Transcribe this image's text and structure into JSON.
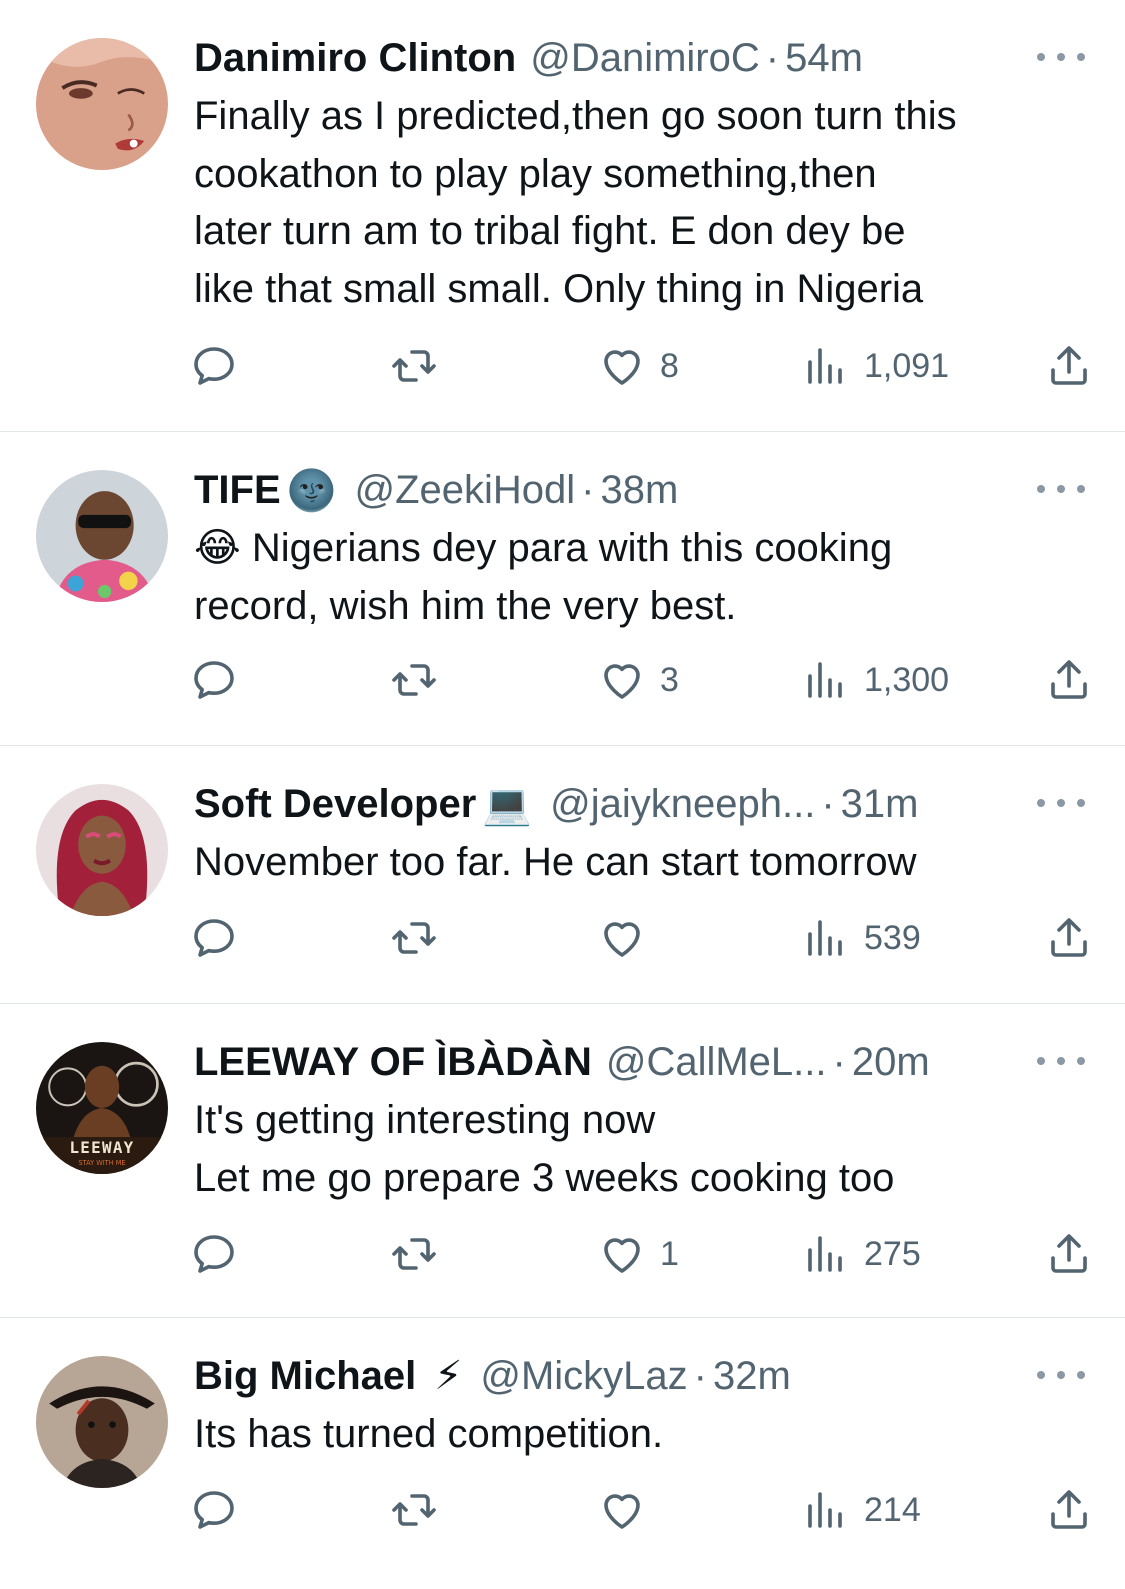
{
  "tweets": [
    {
      "name": "Danimiro Clinton",
      "badge": "",
      "handle": "@DanimiroC",
      "time": "54m",
      "lines": [
        "Finally as I predicted,then go soon turn this",
        "cookathon to play play something,then",
        "later turn am to tribal fight. E don dey be",
        "like that small small. Only thing in Nigeria"
      ],
      "likes": "8",
      "views": "1,091",
      "avatar": "cartoon-woman"
    },
    {
      "name": "TIFE",
      "badge": "🌚",
      "handle": "@ZeekiHodl",
      "time": "38m",
      "lines": [
        "😂 Nigerians dey para with this cooking",
        "record, wish him the very best."
      ],
      "likes": "3",
      "views": "1,300",
      "avatar": "man-sunglasses"
    },
    {
      "name": "Soft Developer",
      "badge": "💻",
      "handle": "@jaiykneeph...",
      "time": "31m",
      "lines": [
        "November too far. He can start tomorrow"
      ],
      "likes": "",
      "views": "539",
      "avatar": "woman-red-braids"
    },
    {
      "name": "LEEWAY OF ÌBÀDÀN",
      "badge": "",
      "handle": "@CallMeL...",
      "time": "20m",
      "lines": [
        "It's getting interesting now",
        "Let me go prepare 3 weeks cooking too"
      ],
      "likes": "1",
      "views": "275",
      "avatar": "leeway-poster",
      "avatar_text": "LEEWAY",
      "avatar_subtext": "STAY WITH ME"
    },
    {
      "name": "Big Michael",
      "badge": "⚡",
      "handle": "@MickyLaz",
      "time": "32m",
      "lines": [
        "Its has turned competition."
      ],
      "likes": "",
      "views": "214",
      "avatar": "man-hat"
    }
  ],
  "separator": "·",
  "icons": {
    "reply": "reply-icon",
    "retweet": "retweet-icon",
    "like": "heart-icon",
    "views": "views-icon",
    "share": "share-icon",
    "more": "more-icon"
  },
  "colors": {
    "text": "#0f1419",
    "secondary": "#536471",
    "divider": "#e1e6ea",
    "icon": "#536471"
  }
}
